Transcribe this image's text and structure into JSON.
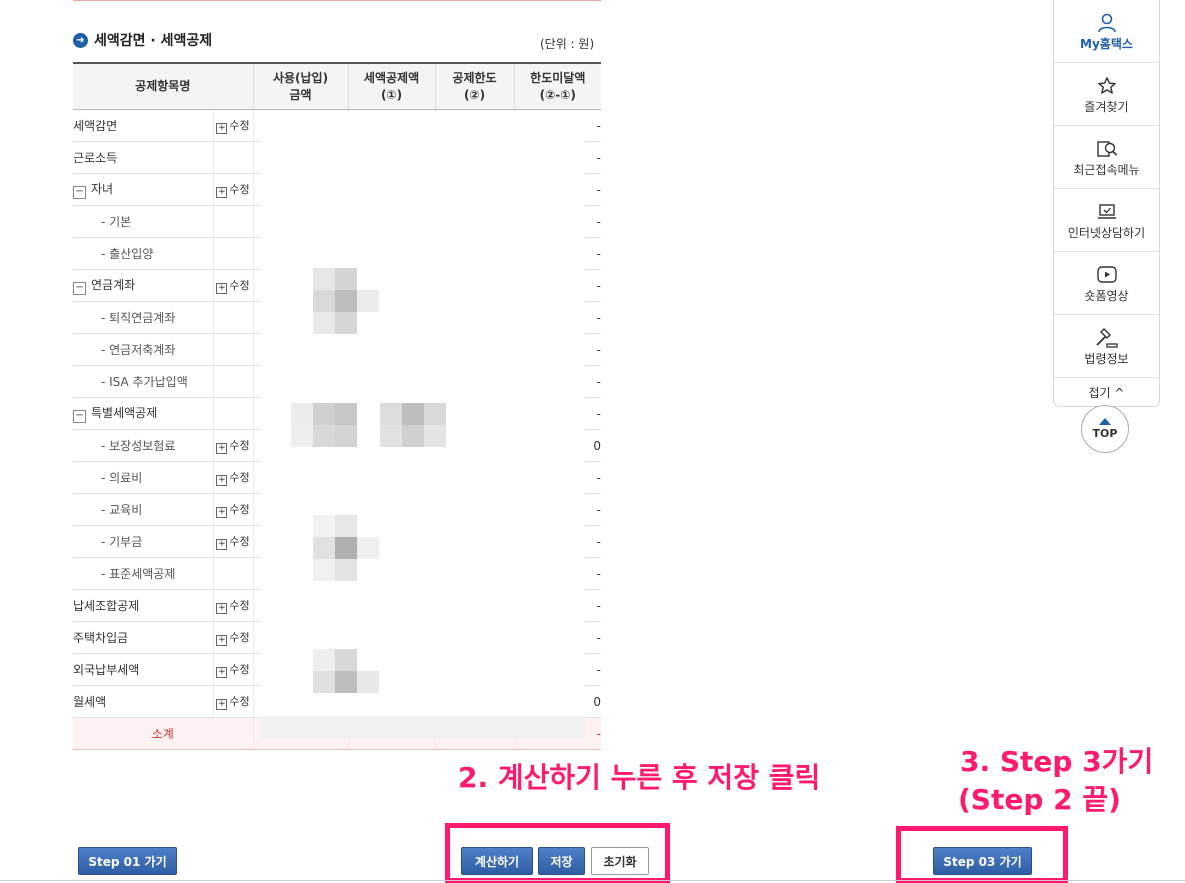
{
  "section": {
    "title": "세액감면 · 세액공제",
    "unit": "(단위 : 원)"
  },
  "table": {
    "headers": [
      "공제항목명",
      "",
      "사용(납입)\n금액",
      "세액공제액\n(①)",
      "공제한도\n(②)",
      "한도미달액\n(②-①)"
    ],
    "rows": [
      {
        "label": "세액감면",
        "level": 0,
        "toggle": "",
        "edit": "수정",
        "last": "-"
      },
      {
        "label": "근로소득",
        "level": 0,
        "toggle": "",
        "edit": "",
        "last": "-"
      },
      {
        "label": "자녀",
        "level": 0,
        "toggle": "−",
        "edit": "수정",
        "last": "-"
      },
      {
        "label": "- 기본",
        "level": 1,
        "toggle": "",
        "edit": "",
        "last": "-"
      },
      {
        "label": "- 출산입양",
        "level": 1,
        "toggle": "",
        "edit": "",
        "last": "-"
      },
      {
        "label": "연금계좌",
        "level": 0,
        "toggle": "−",
        "edit": "수정",
        "last": "-"
      },
      {
        "label": "- 퇴직연금계좌",
        "level": 1,
        "toggle": "",
        "edit": "",
        "last": "-"
      },
      {
        "label": "- 연금저축계좌",
        "level": 1,
        "toggle": "",
        "edit": "",
        "last": "-"
      },
      {
        "label": "- ISA 추가납입액",
        "level": 1,
        "toggle": "",
        "edit": "",
        "last": "-"
      },
      {
        "label": "특별세액공제",
        "level": 0,
        "toggle": "−",
        "edit": "",
        "last": "-"
      },
      {
        "label": "- 보장성보험료",
        "level": 1,
        "toggle": "",
        "edit": "수정",
        "last": "0"
      },
      {
        "label": "- 의료비",
        "level": 1,
        "toggle": "",
        "edit": "수정",
        "last": "-"
      },
      {
        "label": "- 교육비",
        "level": 1,
        "toggle": "",
        "edit": "수정",
        "last": "-"
      },
      {
        "label": "- 기부금",
        "level": 1,
        "toggle": "",
        "edit": "수정",
        "last": "-"
      },
      {
        "label": "- 표준세액공제",
        "level": 1,
        "toggle": "",
        "edit": "",
        "last": "-"
      },
      {
        "label": "납세조합공제",
        "level": 0,
        "toggle": "",
        "edit": "수정",
        "last": "-"
      },
      {
        "label": "주택차입금",
        "level": 0,
        "toggle": "",
        "edit": "수정",
        "last": "-"
      },
      {
        "label": "외국납부세액",
        "level": 0,
        "toggle": "",
        "edit": "수정",
        "last": "-"
      },
      {
        "label": "월세액",
        "level": 0,
        "toggle": "",
        "edit": "수정",
        "last": "0"
      }
    ],
    "subtotal": {
      "label": "소계",
      "last": "-"
    }
  },
  "buttons": {
    "step1": "Step 01 가기",
    "calc": "계산하기",
    "save": "저장",
    "reset": "초기화",
    "step3": "Step 03 가기"
  },
  "annotations": {
    "a2": "2. 계산하기 누른 후 저장 클릭",
    "a3_line1": "3. Step 3가기",
    "a3_line2": "(Step 2 끝)"
  },
  "quick_menu": {
    "items": [
      {
        "label": "My홈택스",
        "icon": "person-icon"
      },
      {
        "label": "즐겨찾기",
        "icon": "star-icon"
      },
      {
        "label": "최근접속메뉴",
        "icon": "recent-search-icon"
      },
      {
        "label": "인터넷상담하기",
        "icon": "laptop-check-icon"
      },
      {
        "label": "숏폼영상",
        "icon": "play-icon"
      },
      {
        "label": "법령정보",
        "icon": "gavel-icon"
      }
    ],
    "fold": "접기 ^",
    "top": "TOP"
  },
  "colors": {
    "accent_blue": "#1f5fa8",
    "annotation_pink": "#ff1a70",
    "subtotal_red": "#cc3333"
  }
}
